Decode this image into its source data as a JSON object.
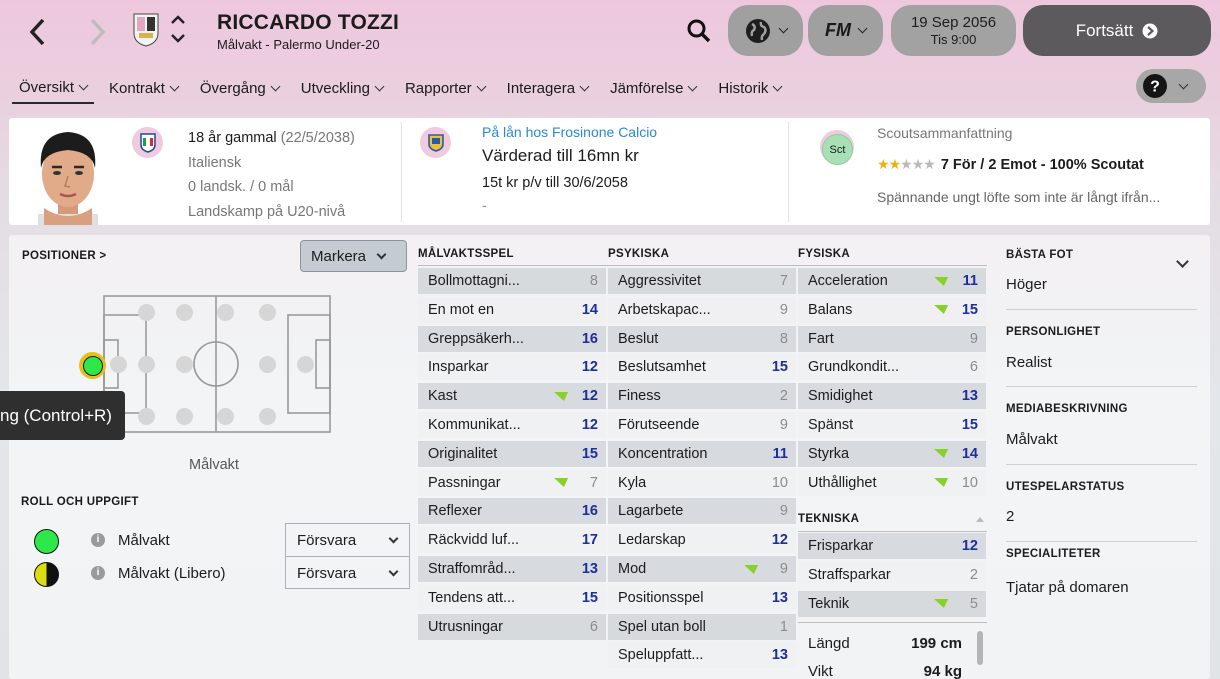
{
  "header": {
    "name": "RICCARDO TOZZI",
    "subtitle": "Målvakt - Palermo Under-20",
    "date": "19 Sep 2056",
    "time": "Tis 9:00",
    "continue_label": "Fortsätt"
  },
  "tabs": [
    "Översikt",
    "Kontrakt",
    "Övergång",
    "Utveckling",
    "Rapporter",
    "Interagera",
    "Jämförelse",
    "Historik"
  ],
  "profile": {
    "age": "18 år gammal",
    "dob": "(22/5/2038)",
    "nationality": "Italiensk",
    "caps": "0 landsk. / 0 mål",
    "intl_level": "Landskamp på U20-nivå"
  },
  "loan": {
    "status": "På lån hos Frosinone Calcio",
    "value": "Värderad till 16mn kr",
    "wage": "15t kr p/v till 30/6/2058",
    "extra": "-"
  },
  "scout": {
    "title": "Scoutsammanfattning",
    "badge": "Sct",
    "stars": 2,
    "summary": "7 För / 2 Emot - 100% Scoutat",
    "note": "Spännande ungt löfte som inte är långt ifrån..."
  },
  "positions": {
    "title": "POSITIONER",
    "mark_label": "Markera",
    "tooltip": "ng (Control+R)",
    "pos_label": "Målvakt"
  },
  "roles": {
    "title": "ROLL OCH UPPGIFT",
    "items": [
      {
        "name": "Målvakt",
        "duty": "Försvara",
        "color": "#2ee84a"
      },
      {
        "name": "Målvakt (Libero)",
        "duty": "Försvara",
        "color": "half"
      }
    ]
  },
  "attributes": {
    "goalkeeping": {
      "title": "MÅLVAKTSSPEL",
      "items": [
        {
          "name": "Bollmottagni...",
          "value": 8,
          "hl": false,
          "up": false
        },
        {
          "name": "En mot en",
          "value": 14,
          "hl": true,
          "up": false
        },
        {
          "name": "Greppsäkerh...",
          "value": 16,
          "hl": true,
          "up": false
        },
        {
          "name": "Insparkar",
          "value": 12,
          "hl": true,
          "up": false
        },
        {
          "name": "Kast",
          "value": 12,
          "hl": true,
          "up": true
        },
        {
          "name": "Kommunikat...",
          "value": 12,
          "hl": true,
          "up": false
        },
        {
          "name": "Originalitet",
          "value": 15,
          "hl": true,
          "up": false
        },
        {
          "name": "Passningar",
          "value": 7,
          "hl": false,
          "up": true
        },
        {
          "name": "Reflexer",
          "value": 16,
          "hl": true,
          "up": false
        },
        {
          "name": "Räckvidd luf...",
          "value": 17,
          "hl": true,
          "up": false
        },
        {
          "name": "Straffområd...",
          "value": 13,
          "hl": true,
          "up": false
        },
        {
          "name": "Tendens att...",
          "value": 15,
          "hl": true,
          "up": false
        },
        {
          "name": "Utrusningar",
          "value": 6,
          "hl": false,
          "up": false
        }
      ]
    },
    "mental": {
      "title": "PSYKISKA",
      "items": [
        {
          "name": "Aggressivitet",
          "value": 7,
          "hl": false,
          "up": false
        },
        {
          "name": "Arbetskapac...",
          "value": 9,
          "hl": false,
          "up": false
        },
        {
          "name": "Beslut",
          "value": 8,
          "hl": false,
          "up": false
        },
        {
          "name": "Beslutsamhet",
          "value": 15,
          "hl": true,
          "up": false
        },
        {
          "name": "Finess",
          "value": 2,
          "hl": false,
          "up": false
        },
        {
          "name": "Förutseende",
          "value": 9,
          "hl": false,
          "up": false
        },
        {
          "name": "Koncentration",
          "value": 11,
          "hl": true,
          "up": false
        },
        {
          "name": "Kyla",
          "value": 10,
          "hl": false,
          "up": false
        },
        {
          "name": "Lagarbete",
          "value": 9,
          "hl": false,
          "up": false
        },
        {
          "name": "Ledarskap",
          "value": 12,
          "hl": true,
          "up": false
        },
        {
          "name": "Mod",
          "value": 9,
          "hl": false,
          "up": true
        },
        {
          "name": "Positionsspel",
          "value": 13,
          "hl": true,
          "up": false
        },
        {
          "name": "Spel utan boll",
          "value": 1,
          "hl": false,
          "up": false
        },
        {
          "name": "Speluppfatt...",
          "value": 13,
          "hl": true,
          "up": false
        }
      ]
    },
    "physical": {
      "title": "FYSISKA",
      "items": [
        {
          "name": "Acceleration",
          "value": 11,
          "hl": true,
          "up": true
        },
        {
          "name": "Balans",
          "value": 15,
          "hl": true,
          "up": true
        },
        {
          "name": "Fart",
          "value": 9,
          "hl": false,
          "up": false
        },
        {
          "name": "Grundkondit...",
          "value": 6,
          "hl": false,
          "up": false
        },
        {
          "name": "Smidighet",
          "value": 13,
          "hl": true,
          "up": false
        },
        {
          "name": "Spänst",
          "value": 15,
          "hl": true,
          "up": false
        },
        {
          "name": "Styrka",
          "value": 14,
          "hl": true,
          "up": true
        },
        {
          "name": "Uthållighet",
          "value": 10,
          "hl": false,
          "up": true
        }
      ]
    },
    "technical": {
      "title": "TEKNISKA",
      "items": [
        {
          "name": "Frisparkar",
          "value": 12,
          "hl": true,
          "up": false
        },
        {
          "name": "Straffsparkar",
          "value": 2,
          "hl": false,
          "up": false
        },
        {
          "name": "Teknik",
          "value": 5,
          "hl": false,
          "up": true
        }
      ]
    },
    "body": [
      {
        "label": "Längd",
        "value": "199 cm"
      },
      {
        "label": "Vikt",
        "value": "94 kg"
      }
    ]
  },
  "side": {
    "foot_title": "BÄSTA FOT",
    "foot": "Höger",
    "pers_title": "PERSONLIGHET",
    "pers": "Realist",
    "media_title": "MEDIABESKRIVNING",
    "media": "Målvakt",
    "out_title": "UTESPELARSTATUS",
    "out": "2",
    "spec_title": "SPECIALITETER",
    "spec": "Tjatar på domaren"
  }
}
